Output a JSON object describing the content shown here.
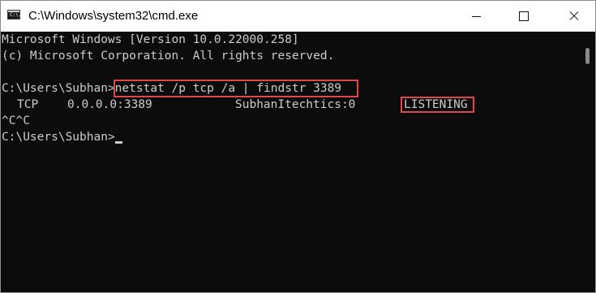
{
  "window": {
    "title": "C:\\Windows\\system32\\cmd.exe",
    "icon": "cmd-app-icon",
    "icon_text": "C:\\."
  },
  "controls": {
    "minimize_icon": "minimize-icon",
    "maximize_icon": "maximize-icon",
    "close_icon": "close-icon"
  },
  "console": {
    "lines": [
      "Microsoft Windows [Version 10.0.22000.258]",
      "(c) Microsoft Corporation. All rights reserved.",
      "",
      "C:\\Users\\Subhan>netstat /p tcp /a | findstr 3389",
      "",
      "^C^C",
      "C:\\Users\\Subhan>"
    ],
    "result_row": {
      "proto": "TCP",
      "local_address": "0.0.0.0:3389",
      "foreign_address": "SubhanItechtics:0",
      "state": "LISTENING"
    }
  },
  "colors": {
    "console_background": "#0c0c0c",
    "console_text": "#cccccc",
    "highlight_border": "#e04848",
    "titlebar_background": "#ffffff"
  }
}
